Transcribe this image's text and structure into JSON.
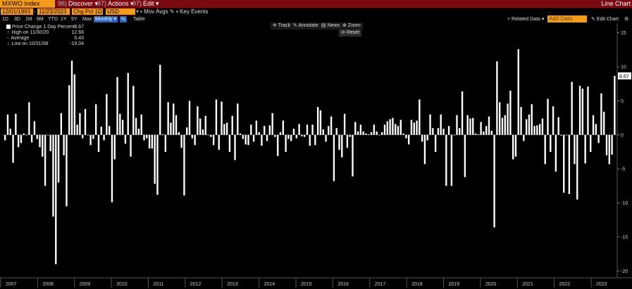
{
  "topbar": {
    "ticker": "MXWO Index",
    "menus": [
      {
        "num": "96)",
        "label": "Discover"
      },
      {
        "num": "97)",
        "label": "Actions"
      },
      {
        "num": "97)",
        "label": "Edit"
      }
    ],
    "title": "Line Chart"
  },
  "controls": {
    "start_date": "12/01/1993",
    "end_date": "11/23/2023",
    "field": "Chg Pct 1D",
    "currency": "USD",
    "mov_avgs": "Mov Avgs",
    "key_events": "Key Events",
    "related_data": "Related Data",
    "add_data_placeholder": "Add Data",
    "edit_chart": "Edit Chart"
  },
  "periods": [
    "1D",
    "3D",
    "1M",
    "6M",
    "YTD",
    "1Y",
    "5Y",
    "Max"
  ],
  "active_period": "Monthly",
  "table_label": "Table",
  "toolbar": {
    "track": "Track",
    "annotate": "Annotate",
    "news": "News",
    "zoom": "Zoom",
    "reset": "Reset"
  },
  "legend": [
    {
      "label": "Price Change 1 Day Percent",
      "value": "8.67"
    },
    {
      "label": "High on 11/30/20",
      "value": "12.66"
    },
    {
      "label": "Average",
      "value": "0.43"
    },
    {
      "label": "Low on 10/31/08",
      "value": "-19.04"
    }
  ],
  "chart_data": {
    "type": "bar",
    "ylim": [
      -21,
      16
    ],
    "yticks": [
      15,
      10,
      5,
      0,
      -5,
      -10,
      -15,
      -20
    ],
    "x_year_labels": [
      "2007",
      "2008",
      "2009",
      "2010",
      "2011",
      "2012",
      "2013",
      "2014",
      "2015",
      "2016",
      "2017",
      "2018",
      "2019",
      "2020",
      "2021",
      "2022",
      "2023"
    ],
    "last_value_label": "8.67",
    "bar_color": "#ffffff",
    "values": [
      -0.8,
      3.0,
      0.9,
      -4.1,
      3.1,
      -1.8,
      -1.2,
      0.2,
      0.0,
      4.8,
      -1.1,
      2.0,
      -0.6,
      -1.8,
      -3.2,
      -7.5,
      0.0,
      -2.4,
      -12.0,
      -19.0,
      -7.0,
      3.2,
      -3.0,
      -10.5,
      7.3,
      10.9,
      8.9,
      1.5,
      3.2,
      -0.5,
      3.8,
      0.0,
      -1.5,
      -0.6,
      4.5,
      -2.5,
      1.2,
      -0.8,
      6.0,
      1.3,
      -9.9,
      -3.6,
      8.5,
      3.1,
      2.2,
      -1.3,
      9.1,
      -3.2,
      7.2,
      2.5,
      0.9,
      3.0,
      -0.8,
      -0.5,
      -2.0,
      -2.0,
      -7.2,
      -8.8,
      10.3,
      0.1,
      -2.5,
      4.8,
      1.8,
      4.6,
      2.9,
      0.4,
      -1.9,
      -8.9,
      1.1,
      5.0,
      -0.5,
      -1.5,
      4.2,
      2.4,
      0.8,
      2.8,
      0.0,
      -0.3,
      -1.5,
      5.2,
      -2.2,
      4.9,
      1.6,
      1.8,
      -2.5,
      2.8,
      -3.7,
      4.6,
      0.2,
      -0.6,
      -1.4,
      -1.5,
      1.5,
      -1.0,
      2.1,
      0.4,
      -1.6,
      1.3,
      -0.9,
      1.4,
      3.2,
      -0.3,
      -3.1,
      0.4,
      2.1,
      -2.5,
      -0.6,
      -0.9,
      0.9,
      -0.5,
      1.6,
      -0.2,
      -0.3,
      1.5,
      -1.6,
      1.5,
      -1.5,
      4.1,
      3.6,
      0.8,
      -1.0,
      1.3,
      2.7,
      -6.8,
      1.0,
      -2.2,
      -3.3,
      3.1,
      -1.9,
      -0.3,
      -6.1,
      1.9,
      0.5,
      1.5,
      0.5,
      0.2,
      0.1,
      0.4,
      1.5,
      0.5,
      0.0,
      0.4,
      1.5,
      2.0,
      2.3,
      2.5,
      1.6,
      1.3,
      2.2,
      0.2,
      -0.5,
      -1.4,
      2.2,
      1.8,
      2.1,
      5.2,
      -1.0,
      -4.3,
      -0.8,
      3.0,
      1.0,
      -2.5,
      1.0,
      3.0,
      0.9,
      -7.5,
      1.3,
      -7.5,
      0.0,
      2.9,
      1.0,
      6.4,
      -6.2,
      2.9,
      2.4,
      2.5,
      0.2,
      0.1,
      1.9,
      0.5,
      1.3,
      2.7,
      0.6,
      -13.6,
      10.8,
      4.8,
      2.5,
      2.9,
      4.6,
      6.5,
      -3.6,
      -3.2,
      12.6,
      4.1,
      -0.9,
      2.3,
      3.0,
      4.5,
      1.3,
      1.4,
      1.6,
      2.4,
      -4.3,
      5.3,
      -2.5,
      4.2,
      -5.4,
      2.6,
      -0.1,
      -8.5,
      0.0,
      -8.7,
      7.8,
      -4.3,
      -9.5,
      7.2,
      6.8,
      -4.2,
      7.1,
      -2.5,
      2.9,
      1.6,
      -1.2,
      6.1,
      3.4,
      -3.0,
      -4.3,
      -2.9,
      8.67
    ]
  }
}
